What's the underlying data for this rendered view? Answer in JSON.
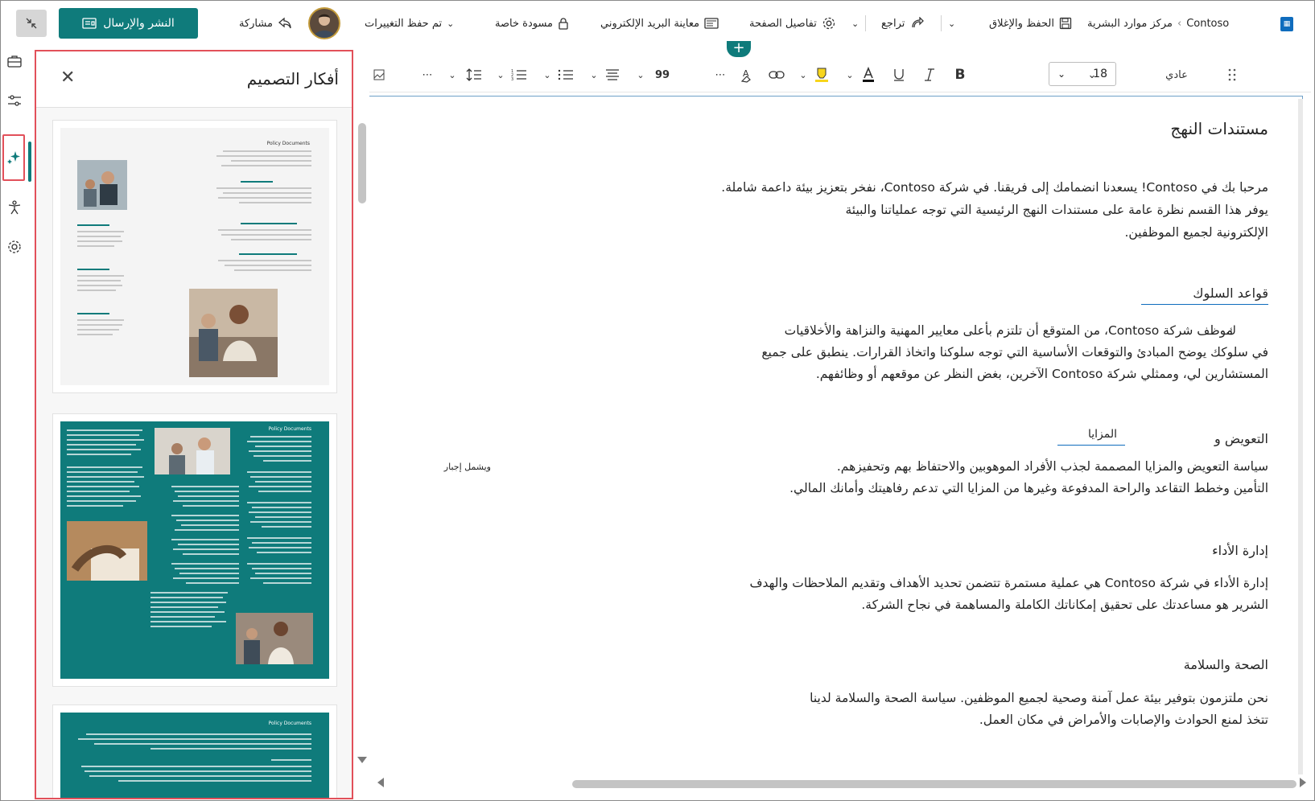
{
  "topbar": {
    "site_name": "Contoso",
    "site_sub": "مركز موارد البشرية",
    "save_close": "الحفظ والإغلاق",
    "undo": "تراجع",
    "page_details": "تفاصيل الصفحة",
    "email_preview": "معاينة البريد الإلكتروني",
    "private_draft": "مسودة خاصة",
    "saved": "تم حفظ التغييرات",
    "share": "مشاركة",
    "publish": "النشر والإرسال"
  },
  "panel": {
    "title": "أفكار التصميم",
    "thumb_heading": "Policy Documents"
  },
  "toolbar": {
    "style": "عادي",
    "font_size": "18",
    "quote": "99"
  },
  "document": {
    "title": "مستندات النهج",
    "intro_1": "مرحبا بك في Contoso!     يسعدنا انضمامك إلى فريقنا. في شركة Contoso، نفخر بتعزيز بيئة داعمة شاملة.",
    "intro_2": "يوفر هذا القسم نظرة عامة على مستندات النهج الرئيسية التي توجه عملياتنا والبيئة",
    "intro_3": "الإلكترونية لجميع الموظفين.",
    "h_conduct": "قواعد السلوك",
    "conduct_lead": "ك",
    "conduct_1": "موظف شركة Contoso، من المتوقع أن تلتزم بأعلى معايير المهنية والنزاهة والأخلاقيات",
    "conduct_2": "في سلوكك يوضح المبادئ والتوقعات الأساسية التي توجه سلوكنا واتخاذ القرارات. ينطبق على جميع",
    "conduct_3": "المستشارين لي، وممثلي شركة Contoso الآخرين، بغض النظر عن موقعهم أو وظائفهم.",
    "h_comp_a": "التعويض و",
    "h_comp_b": "المزايا",
    "comp_small": "ويشمل إجبار",
    "comp_1": "سياسة التعويض والمزايا المصممة لجذب الأفراد الموهوبين والاحتفاظ بهم وتحفيزهم.",
    "comp_2": "التأمين وخطط التقاعد والراحة المدفوعة وغيرها من المزايا التي تدعم رفاهيتك وأمانك المالي.",
    "h_perf": "إدارة الأداء",
    "perf_1": "إدارة الأداء في شركة Contoso هي عملية مستمرة تتضمن تحديد الأهداف وتقديم الملاحظات والهدف",
    "perf_2": "الشرير هو مساعدتك على تحقيق إمكاناتك الكاملة والمساهمة في نجاح الشركة.",
    "h_health": "الصحة والسلامة",
    "health_1": "نحن ملتزمون بتوفير بيئة عمل آمنة وصحية لجميع الموظفين. سياسة الصحة والسلامة لدينا",
    "health_2": "تتخذ لمنع الحوادث والإصابات والأمراض في مكان العمل."
  },
  "colors": {
    "accent": "#0f7b7b",
    "highlight_border": "#e2505a"
  }
}
